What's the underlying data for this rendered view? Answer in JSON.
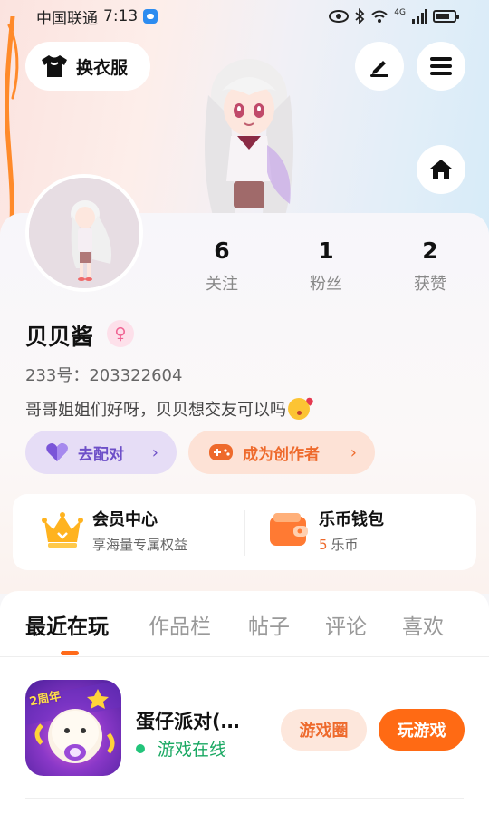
{
  "status_bar": {
    "carrier": "中国联通",
    "time": "7:13",
    "network": "4G"
  },
  "header": {
    "outfit_label": "换衣服",
    "icons": [
      "tshirt-icon",
      "edit-icon",
      "menu-icon",
      "home-icon"
    ]
  },
  "profile": {
    "stats": [
      {
        "value": "6",
        "label": "关注"
      },
      {
        "value": "1",
        "label": "粉丝"
      },
      {
        "value": "2",
        "label": "获赞"
      }
    ],
    "name": "贝贝酱",
    "gender": "female",
    "id_text": "233号：203322604",
    "bio": "哥哥姐姐们好呀，贝贝想交友可以吗"
  },
  "actions": {
    "match_label": "去配对",
    "creator_label": "成为创作者"
  },
  "member_card": {
    "vip_title": "会员中心",
    "vip_sub": "享海量专属权益",
    "wallet_title": "乐币钱包",
    "wallet_count": "5",
    "wallet_unit": "乐币"
  },
  "tabs": [
    {
      "label": "最近在玩",
      "active": true
    },
    {
      "label": "作品栏",
      "active": false
    },
    {
      "label": "帖子",
      "active": false
    },
    {
      "label": "评论",
      "active": false
    },
    {
      "label": "喜欢",
      "active": false
    }
  ],
  "games": [
    {
      "name": "蛋仔派对(…",
      "status": "游戏在线",
      "icon_badge": "2周年",
      "circle_label": "游戏圈",
      "play_label": "玩游戏"
    }
  ],
  "colors": {
    "accent_orange": "#ff6a14",
    "purple": "#6d4fc8",
    "online_green": "#19a862"
  }
}
